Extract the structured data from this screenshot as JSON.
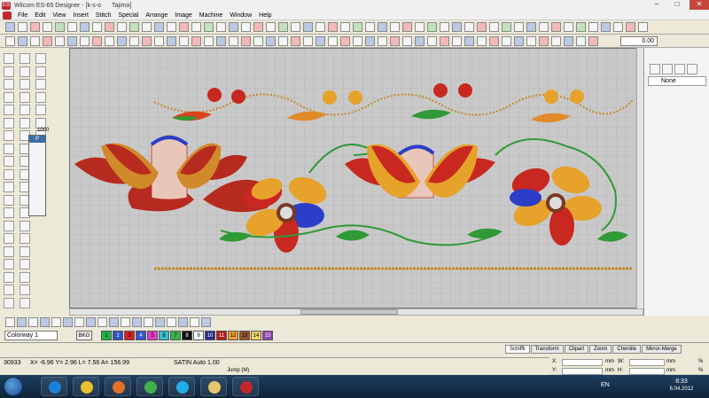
{
  "window": {
    "app_icon": "ES",
    "title": "Wilcom ES-65 Designer - [k-s-o",
    "title_extra": "Tajima]",
    "controls": [
      "–",
      "□",
      "✕"
    ]
  },
  "menu": [
    "File",
    "Edit",
    "View",
    "Insert",
    "Stitch",
    "Special",
    "Arrange",
    "Image",
    "Machine",
    "Window",
    "Help"
  ],
  "toolbar": {
    "zoom_value": "0.00"
  },
  "floating_palette": {
    "label": "1000"
  },
  "right_panel": {
    "select_value": "None"
  },
  "colors": {
    "colorway": "Colorway 1",
    "bkg": "BKG",
    "swatches": [
      {
        "num": "1",
        "color": "#1db44a"
      },
      {
        "num": "2",
        "color": "#2a56c6"
      },
      {
        "num": "3",
        "color": "#d81e1e"
      },
      {
        "num": "4",
        "color": "#3b4fd8"
      },
      {
        "num": "5",
        "color": "#e23ccb"
      },
      {
        "num": "6",
        "color": "#31c0c8"
      },
      {
        "num": "7",
        "color": "#37b24d"
      },
      {
        "num": "8",
        "color": "#111111"
      },
      {
        "num": "9",
        "color": "#ffffff"
      },
      {
        "num": "10",
        "color": "#2a2a8c"
      },
      {
        "num": "11",
        "color": "#b71c1c"
      },
      {
        "num": "12",
        "color": "#f0a030"
      },
      {
        "num": "13",
        "color": "#a0522d"
      },
      {
        "num": "14",
        "color": "#f5d06a"
      },
      {
        "num": "15",
        "color": "#8e44ad"
      }
    ]
  },
  "tabs": [
    "Schiffli",
    "Transform",
    "Clipart",
    "Zoom",
    "Chenille",
    "Mirror-Merge"
  ],
  "status": {
    "stitches": "30933",
    "coords": "X= -6.96 Y= 2.96 L= 7.56 A= 156.99",
    "mode": "SATIN Auto 1.00",
    "jump": "Jump (M)",
    "x_label": "X:",
    "y_label": "Y:",
    "w_label": "W:",
    "h_label": "H:",
    "unit": "mm",
    "pct": "%"
  },
  "taskbar": {
    "lang": "EN",
    "time": "8:33",
    "date": "6.04.2012",
    "apps": [
      {
        "name": "internet-explorer",
        "color": "#1e7fd8"
      },
      {
        "name": "chrome",
        "color": "#e8c12f"
      },
      {
        "name": "firefox",
        "color": "#e0702a"
      },
      {
        "name": "messenger",
        "color": "#3fb04a"
      },
      {
        "name": "skype",
        "color": "#1faee9"
      },
      {
        "name": "explorer",
        "color": "#e8c66a"
      },
      {
        "name": "wilcom",
        "color": "#c0282d"
      }
    ]
  }
}
